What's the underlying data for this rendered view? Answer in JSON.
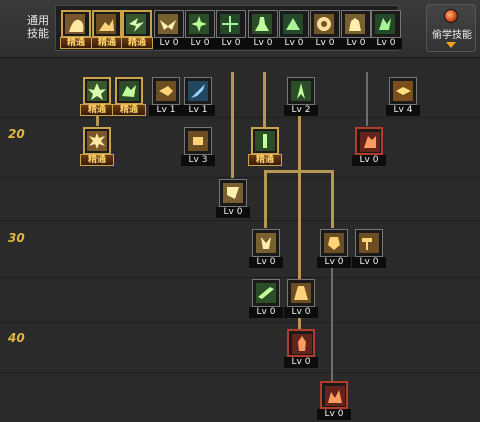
{
  "header": {
    "common_skills_label": "通用\n技能",
    "steal_skill_label": "偷学技能"
  },
  "level_labels": [
    "20",
    "30",
    "40"
  ],
  "common_skills": [
    {
      "name": "common-skill-1",
      "status": "精通",
      "icon": "bear-hug-icon"
    },
    {
      "name": "common-skill-2",
      "status": "精通",
      "icon": "crouch-kick-icon"
    },
    {
      "name": "common-skill-3",
      "status": "精通",
      "icon": "dash-icon"
    },
    {
      "name": "common-skill-4",
      "status": "Lv 0",
      "icon": "eagle-icon"
    },
    {
      "name": "common-skill-5",
      "status": "Lv 0",
      "icon": "target-burst-icon"
    },
    {
      "name": "common-skill-6",
      "status": "Lv 0",
      "icon": "crosshair-icon"
    },
    {
      "name": "common-skill-7",
      "status": "Lv 0",
      "icon": "stomp-icon"
    },
    {
      "name": "common-skill-8",
      "status": "Lv 0",
      "icon": "ground-slam-icon"
    },
    {
      "name": "common-skill-9",
      "status": "Lv 0",
      "icon": "ring-icon"
    },
    {
      "name": "common-skill-10",
      "status": "Lv 0",
      "icon": "flex-icon"
    },
    {
      "name": "common-skill-11",
      "status": "Lv 0",
      "icon": "spin-kick-icon"
    }
  ],
  "tree_skills": [
    {
      "name": "tree-skill-r1-1",
      "status": "精通",
      "icon": "leaf-burst-icon"
    },
    {
      "name": "tree-skill-r1-2",
      "status": "精通",
      "icon": "leap-icon"
    },
    {
      "name": "tree-skill-r1-3",
      "status": "Lv 1",
      "icon": "palm-strike-icon"
    },
    {
      "name": "tree-skill-r1-4",
      "status": "Lv 1",
      "icon": "blue-slash-icon"
    },
    {
      "name": "tree-skill-r1-5",
      "status": "Lv 2",
      "icon": "leaf-spike-icon"
    },
    {
      "name": "tree-skill-r1-6",
      "status": "Lv 4",
      "icon": "fireball-icon"
    },
    {
      "name": "tree-skill-r2-1",
      "status": "精通",
      "icon": "explosion-icon"
    },
    {
      "name": "tree-skill-r2-2",
      "status": "Lv 3",
      "icon": "fist-icon"
    },
    {
      "name": "tree-skill-r2-3",
      "status": "精通",
      "icon": "pillar-icon"
    },
    {
      "name": "tree-skill-r2-4",
      "status": "Lv 0",
      "icon": "fire-dragon-icon"
    },
    {
      "name": "tree-skill-r3-1",
      "status": "Lv 0",
      "icon": "grab-icon"
    },
    {
      "name": "tree-skill-r4-1",
      "status": "Lv 0",
      "icon": "combo-icon"
    },
    {
      "name": "tree-skill-r4-2",
      "status": "Lv 0",
      "icon": "headbutt-icon"
    },
    {
      "name": "tree-skill-r4-3",
      "status": "Lv 0",
      "icon": "hammer-icon"
    },
    {
      "name": "tree-skill-r5-1",
      "status": "Lv 0",
      "icon": "wind-slash-icon"
    },
    {
      "name": "tree-skill-r5-2",
      "status": "Lv 0",
      "icon": "power-stance-icon"
    },
    {
      "name": "tree-skill-r6-1",
      "status": "Lv 0",
      "icon": "flame-aura-icon"
    },
    {
      "name": "tree-skill-r7-1",
      "status": "Lv 0",
      "icon": "inferno-icon"
    }
  ],
  "colors": {
    "mastered_border": "#c9a24a",
    "connector_gold": "#b89654",
    "connector_grey": "#6e6e6e",
    "level_label": "#e2b640",
    "ultimate_border": "#b43a2a"
  }
}
